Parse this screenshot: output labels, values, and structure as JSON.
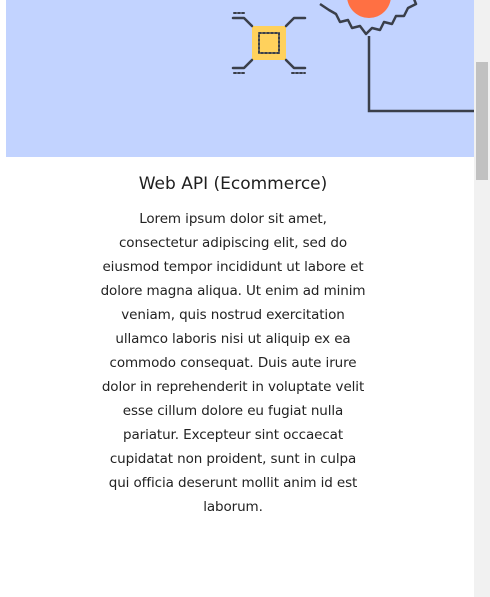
{
  "card": {
    "title": "Web API (Ecommerce)",
    "description": "Lorem ipsum dolor sit amet, consectetur adipiscing elit, sed do eiusmod tempor incididunt ut labore et dolore magna aliqua. Ut enim ad minim veniam, quis nostrud exercitation ullamco laboris nisi ut aliquip ex ea commodo consequat. Duis aute irure dolor in reprehenderit in voluptate velit esse cillum dolore eu fugiat nulla pariatur. Excepteur sint occaecat cupidatat non proident, sunt in culpa qui officia deserunt mollit anim id est laborum."
  },
  "illustration": {
    "icons": [
      "chip-icon",
      "gear-icon"
    ],
    "colors": {
      "background": "#c2d3ff",
      "chip": "#ffd15c",
      "gear_center": "#ff7043",
      "stroke": "#3a3f4a"
    }
  }
}
